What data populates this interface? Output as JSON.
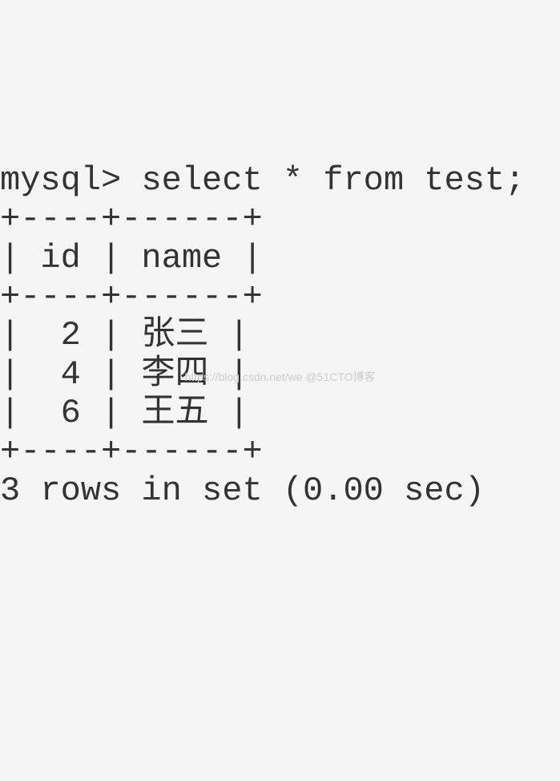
{
  "prompt": "mysql> ",
  "command": "select * from test;",
  "table": {
    "border_top": "+----+------+",
    "header_row": "| id | name |",
    "border_mid": "+----+------+",
    "rows": [
      {
        "id": "2",
        "name": "张三"
      },
      {
        "id": "4",
        "name": "李四"
      },
      {
        "id": "6",
        "name": "王五"
      }
    ],
    "border_bottom": "+----+------+"
  },
  "result_summary": "3 rows in set (0.00 sec)",
  "watermark": "https://blog.csdn.net/we @51CTO博客"
}
